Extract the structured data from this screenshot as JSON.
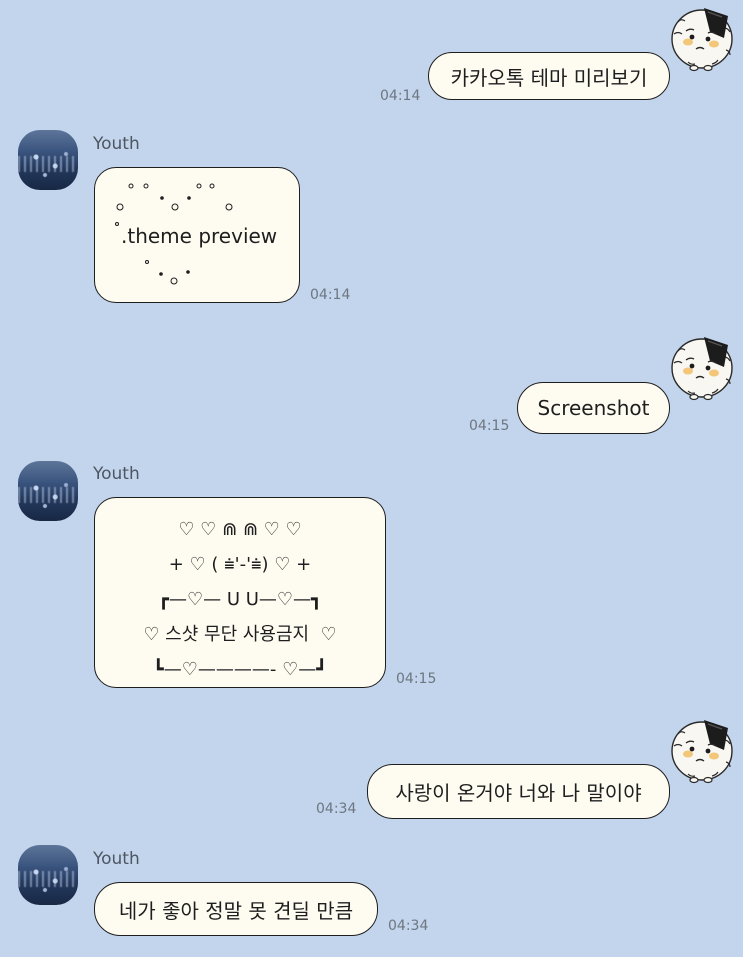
{
  "contact_name": "Youth",
  "messages": [
    {
      "id": "m1",
      "side": "me",
      "text": "카카오톡 테마 미리보기",
      "time": "04:14"
    },
    {
      "id": "m2",
      "side": "them",
      "name": "Youth",
      "text": ".theme preview",
      "time": "04:14"
    },
    {
      "id": "m3",
      "side": "me",
      "text": "Screenshot",
      "time": "04:15"
    },
    {
      "id": "m4",
      "side": "them",
      "name": "Youth",
      "lines": [
        "♡ ♡ ⋒ ⋒ ♡ ♡",
        "+ ♡ ( ⩧'-'⩧) ♡ +",
        "┏—♡— U U—♡—┓",
        "♡ 스샷 무단 사용금지  ♡",
        "┗—♡————- ♡—┛"
      ],
      "time": "04:15"
    },
    {
      "id": "m5",
      "side": "me",
      "text": "사랑이 온거야 너와 나 말이야",
      "time": "04:34"
    },
    {
      "id": "m6",
      "side": "them",
      "name": "Youth",
      "text": "네가 좋아 정말 못 견딜 만큼",
      "time": "04:34"
    }
  ],
  "icons": {
    "my_avatar": "rice-ball-character-icon",
    "their_avatar": "ocean-photo-avatar"
  }
}
